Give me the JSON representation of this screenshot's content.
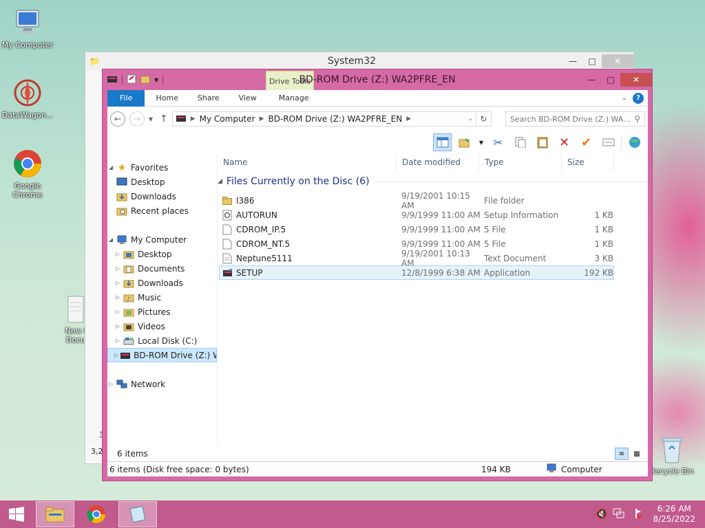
{
  "desktop": {
    "icons": [
      {
        "label": "My Computer"
      },
      {
        "label": "DataWagon..."
      },
      {
        "label": "Google Chrome"
      },
      {
        "label": "New I Docu"
      },
      {
        "label": "Recycle Bin"
      }
    ]
  },
  "back_window": {
    "title": "System32",
    "status_partial": "3,2",
    "side_partial": "3"
  },
  "window": {
    "title": "BD-ROM Drive (Z:) WA2PFRE_EN",
    "context_tab_group": "Drive Tools",
    "ribbon_tabs": [
      "File",
      "Home",
      "Share",
      "View",
      "Manage"
    ],
    "address": {
      "crumbs": [
        "My Computer",
        "BD-ROM Drive (Z:) WA2PFRE_EN"
      ],
      "search_placeholder": "Search BD-ROM Drive (Z:) WA..."
    },
    "nav": {
      "favorites": {
        "label": "Favorites",
        "items": [
          "Desktop",
          "Downloads",
          "Recent places"
        ]
      },
      "computer": {
        "label": "My Computer",
        "items": [
          "Desktop",
          "Documents",
          "Downloads",
          "Music",
          "Pictures",
          "Videos",
          "Local Disk (C:)",
          "BD-ROM Drive (Z:) W"
        ]
      },
      "network": {
        "label": "Network"
      }
    },
    "columns": {
      "name": "Name",
      "date": "Date modified",
      "type": "Type",
      "size": "Size"
    },
    "group_header": "Files Currently on the Disc (6)",
    "files": [
      {
        "name": "I386",
        "date": "9/19/2001 10:15 AM",
        "type": "File folder",
        "size": "",
        "icon": "folder-icon"
      },
      {
        "name": "AUTORUN",
        "date": "9/9/1999 11:00 AM",
        "type": "Setup Information",
        "size": "1 KB",
        "icon": "setup-info-icon"
      },
      {
        "name": "CDROM_IP.5",
        "date": "9/9/1999 11:00 AM",
        "type": "5 File",
        "size": "1 KB",
        "icon": "file-icon"
      },
      {
        "name": "CDROM_NT.5",
        "date": "9/9/1999 11:00 AM",
        "type": "5 File",
        "size": "1 KB",
        "icon": "file-icon"
      },
      {
        "name": "Neptune5111",
        "date": "9/19/2001 10:13 AM",
        "type": "Text Document",
        "size": "3 KB",
        "icon": "text-file-icon"
      },
      {
        "name": "SETUP",
        "date": "12/8/1999 6:38 AM",
        "type": "Application",
        "size": "192 KB",
        "icon": "application-icon"
      }
    ],
    "item_count": "6 items",
    "details_bar": {
      "summary": "6 items (Disk free space: 0 bytes)",
      "size": "194 KB",
      "location": "Computer"
    }
  },
  "taskbar": {
    "time": "6:26 AM",
    "date": "8/25/2022"
  },
  "colors": {
    "window_frame": "#d56aa6",
    "accent": "#1979ca",
    "taskbar": "#be4682"
  }
}
